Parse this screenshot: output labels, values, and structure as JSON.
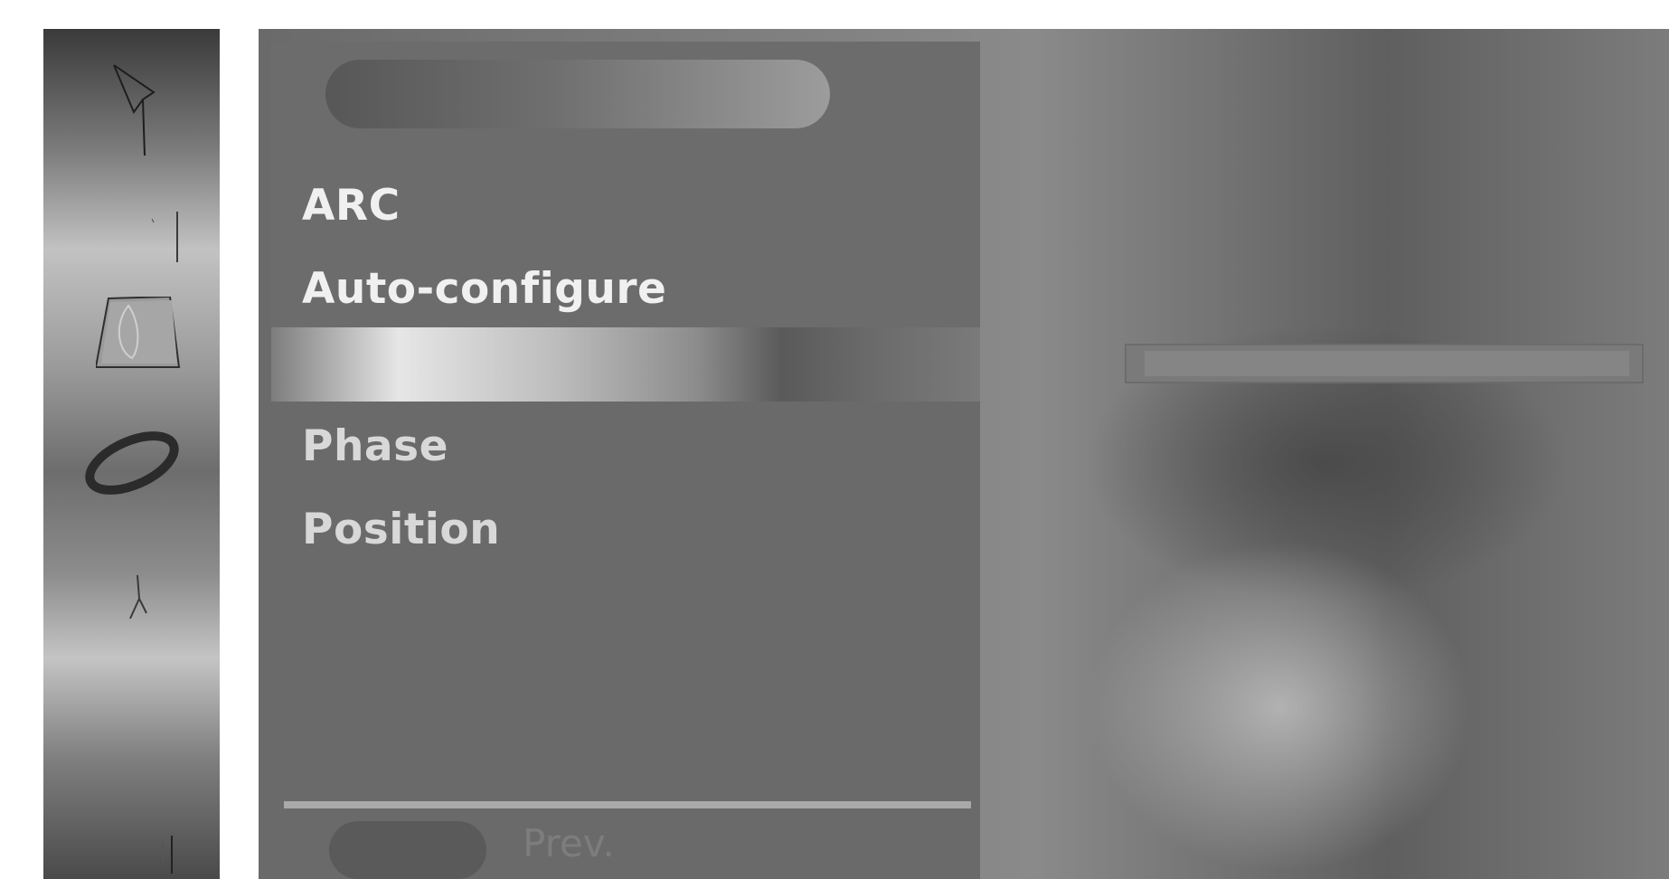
{
  "sidebar": {
    "icons": [
      {
        "name": "picture-icon"
      },
      {
        "name": "sound-icon"
      },
      {
        "name": "screen-icon"
      },
      {
        "name": "option-icon"
      },
      {
        "name": "lock-icon"
      },
      {
        "name": "remote-icon"
      }
    ]
  },
  "menu": {
    "items": [
      {
        "label": "ARC"
      },
      {
        "label": "Auto-configure"
      },
      {
        "label": ""
      },
      {
        "label": "Phase"
      },
      {
        "label": "Position"
      }
    ],
    "footer": {
      "prev_label": "Prev."
    }
  },
  "colors": {
    "panel": "#6c6c6c",
    "text": "#f0f0f0",
    "highlight_band": "#e6e6e6"
  }
}
